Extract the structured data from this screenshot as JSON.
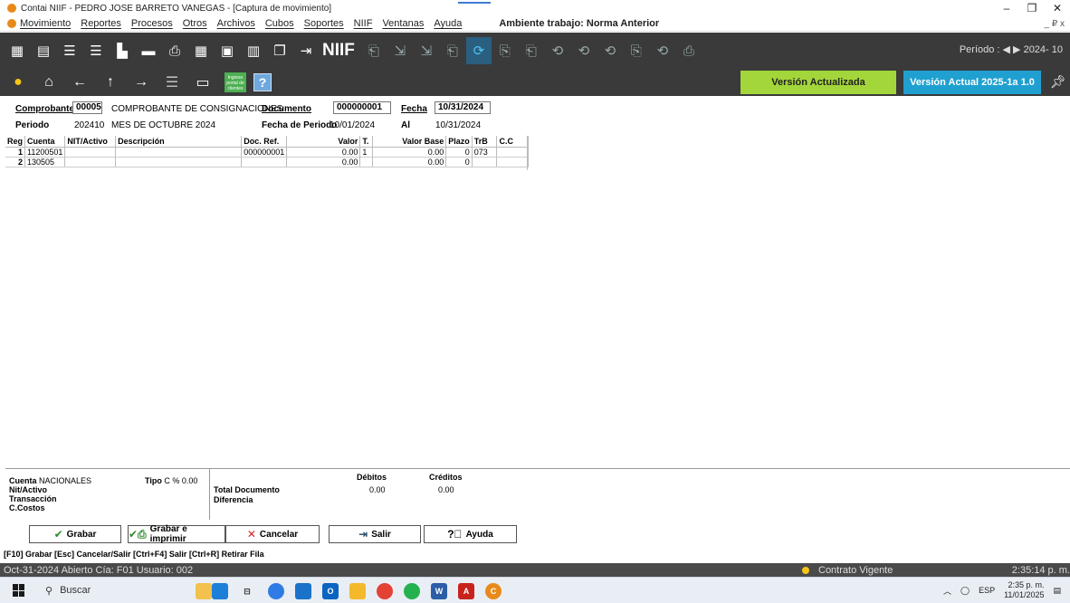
{
  "window": {
    "title": "Contai NIIF - PEDRO JOSE BARRETO VANEGAS - [Captura de movimiento]",
    "controls": [
      "–",
      "❐",
      "✕"
    ]
  },
  "menu": {
    "items": [
      "Movimiento",
      "Reportes",
      "Procesos",
      "Otros",
      "Archivos",
      "Cubos",
      "Soportes",
      "NIIF",
      "Ventanas",
      "Ayuda"
    ],
    "ambiente": "Ambiente trabajo: Norma Anterior",
    "mdi_controls": "_ ₽ x"
  },
  "toolbar": {
    "niif_label": "NIIF",
    "periodo_label": "Período : ◀ ▶  2024- 10"
  },
  "toolbar2": {
    "portal_label": "Ingreso portal de clientes",
    "help_label": "?",
    "version_updated": "Versión Actualizada",
    "version_current": "Versión Actual 2025-1a 1.0"
  },
  "header": {
    "comprobante_label": "Comprobante",
    "comprobante_code": "00005",
    "comprobante_name": "COMPROBANTE DE CONSIGNACIONES",
    "documento_label": "Documento",
    "documento_value": "000000001",
    "fecha_label": "Fecha",
    "fecha_value": "10/31/2024",
    "periodo_label": "Periodo",
    "periodo_value": "202410",
    "periodo_name": "MES DE OCTUBRE 2024",
    "fecha_periodo_label": "Fecha de Periodo",
    "fecha_periodo_value": "10/01/2024",
    "al_label": "Al",
    "al_value": "10/31/2024"
  },
  "grid": {
    "columns": [
      "Reg",
      "Cuenta",
      "NIT/Activo",
      "Descripción",
      "Doc. Ref.",
      "Valor",
      "T.",
      "Valor Base",
      "Plazo",
      "TrB",
      "C.C"
    ],
    "rows": [
      [
        "1",
        "11200501",
        "",
        "",
        "000000001",
        "0.00",
        "1",
        "0.00",
        "0",
        "073",
        ""
      ],
      [
        "2",
        "130505",
        "",
        "",
        "",
        "0.00",
        "",
        "0.00",
        "0",
        "",
        ""
      ]
    ]
  },
  "summary": {
    "cuenta_label": "Cuenta",
    "cuenta_value": "NACIONALES",
    "tipo_label": "Tipo",
    "tipo_value": "C  %  0.00",
    "nit_label": "Nit/Activo",
    "transaccion_label": "Transacción",
    "ccostos_label": "C.Costos",
    "total_label": "Total Documento",
    "diferencia_label": "Diferencia",
    "debitos_label": "Débitos",
    "creditos_label": "Créditos",
    "debitos_value": "0.00",
    "creditos_value": "0.00"
  },
  "buttons": {
    "grabar": "Grabar",
    "grabar_imprimir": "Grabar e imprimir",
    "cancelar": "Cancelar",
    "salir": "Salir",
    "ayuda": "Ayuda"
  },
  "shortcuts": "[F10] Grabar   [Esc] Cancelar/Salir  [Ctrl+F4] Salir   [Ctrl+R] Retirar Fila",
  "status": {
    "left": "Oct-31-2024   Abierto    Cía: F01   Usuario: 002",
    "contrato": "Contrato Vigente",
    "time": "2:35:14 p. m."
  },
  "taskbar": {
    "search_placeholder": "Buscar",
    "lang": "ESP",
    "clock_time": "2:35 p. m.",
    "clock_date": "11/01/2025"
  },
  "colors": {
    "toolbar_bg": "#3a3a3a",
    "version_updated_bg": "#a3d63a",
    "version_current_bg": "#1fa0d0",
    "status_dot": "#f5c518"
  }
}
